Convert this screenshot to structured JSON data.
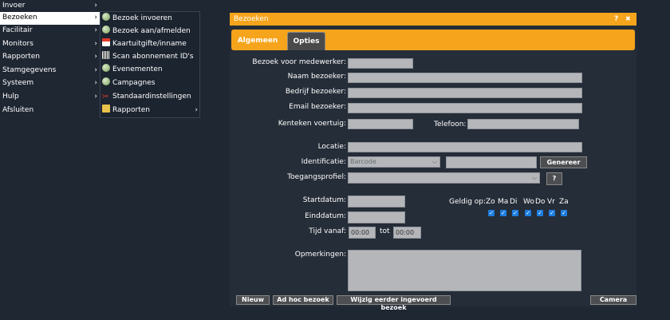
{
  "mainmenu": [
    {
      "label": "Invoer",
      "arrow": "›"
    },
    {
      "label": "Bezoeken",
      "arrow": "›"
    },
    {
      "label": "Facilitair",
      "arrow": "›"
    },
    {
      "label": "Monitors",
      "arrow": "›"
    },
    {
      "label": "Rapporten",
      "arrow": "›"
    },
    {
      "label": "Stamgegevens",
      "arrow": "›"
    },
    {
      "label": "Systeem",
      "arrow": "›"
    },
    {
      "label": "Hulp",
      "arrow": "›"
    },
    {
      "label": "Afsluiten"
    }
  ],
  "submenu": [
    {
      "label": "Bezoek invoeren",
      "icon": "globe-icon"
    },
    {
      "label": "Bezoek aan/afmelden",
      "icon": "globe-icon"
    },
    {
      "label": "Kaartuitgifte/inname",
      "icon": "card-icon"
    },
    {
      "label": "Scan abonnement ID's",
      "icon": "scan-icon"
    },
    {
      "label": "Evenementen",
      "icon": "globe-icon"
    },
    {
      "label": "Campagnes",
      "icon": "globe-icon"
    },
    {
      "label": "Standaardinstellingen",
      "icon": "tools-icon"
    },
    {
      "label": "Rapporten",
      "icon": "report-icon",
      "arrow": "›"
    }
  ],
  "dialog": {
    "title": "Bezoeken",
    "help": "?",
    "close": "✖",
    "tabs": [
      "Algemeen",
      "Opties"
    ]
  },
  "form": {
    "medewerker": "Bezoek voor medewerker:",
    "naam": "Naam bezoeker:",
    "bedrijf": "Bedrijf bezoeker:",
    "email": "Email bezoeker:",
    "kenteken": "Kenteken voertuig:",
    "telefoon": "Telefoon:",
    "locatie": "Locatie:",
    "identificatie": "Identificatie:",
    "identificatie_value": "Barcode",
    "genereer": "Genereer",
    "toegang": "Toegangsprofiel:",
    "toegang_help": "?",
    "startdatum": "Startdatum:",
    "einddatum": "Einddatum:",
    "tijd": "Tijd vanaf:",
    "tijd_van": "00:00",
    "tot": "tot",
    "tijd_tot": "00:00",
    "geldig": "Geldig op:",
    "days": [
      "Zo",
      "Ma",
      "Di",
      "Wo",
      "Do",
      "Vr",
      "Za"
    ],
    "opmerkingen": "Opmerkingen:"
  },
  "buttons": {
    "nieuw": "Nieuw",
    "adhoc": "Ad hoc bezoek",
    "wijzig": "Wijzig eerder ingevoerd bezoek",
    "camera": "Camera"
  },
  "colors": {
    "accent": "#f5a41b",
    "background": "#1f2733",
    "checkbox": "#1d7de0"
  }
}
